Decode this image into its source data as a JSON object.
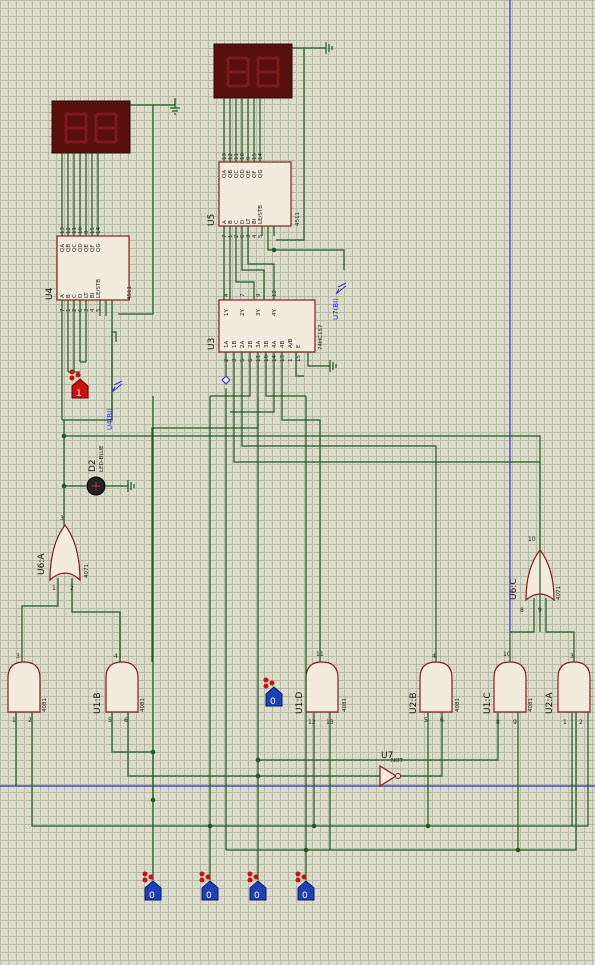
{
  "parts": {
    "U4": {
      "ref": "U4",
      "type": "4511",
      "outputs": [
        "QA",
        "QB",
        "QC",
        "QD",
        "QE",
        "QF",
        "QG"
      ],
      "out_pins": [
        "13",
        "12",
        "11",
        "10",
        "9",
        "15",
        "14"
      ],
      "inputs": [
        "A",
        "B",
        "C",
        "D",
        "LT",
        "BI",
        "LE/STB"
      ],
      "in_pins": [
        "7",
        "1",
        "2",
        "6",
        "3",
        "4",
        "5"
      ]
    },
    "U5": {
      "ref": "U5",
      "type": "4511",
      "outputs": [
        "QA",
        "QB",
        "QC",
        "QD",
        "QE",
        "QF",
        "QG"
      ],
      "out_pins": [
        "13",
        "12",
        "11",
        "10",
        "9",
        "15",
        "14"
      ],
      "inputs": [
        "A",
        "B",
        "C",
        "D",
        "LT",
        "BI",
        "LE/STB"
      ],
      "in_pins": [
        "7",
        "1",
        "2",
        "6",
        "3",
        "4",
        "5"
      ]
    },
    "U3": {
      "ref": "U3",
      "type": "74HC157",
      "outputs": [
        "1Y",
        "2Y",
        "3Y",
        "4Y"
      ],
      "out_pins": [
        "4",
        "7",
        "9",
        "12"
      ],
      "inputs": [
        "1A",
        "1B",
        "2A",
        "2B",
        "3A",
        "3B",
        "4A",
        "4B",
        "A/B",
        "E"
      ],
      "in_pins": [
        "2",
        "3",
        "5",
        "6",
        "11",
        "10",
        "14",
        "13",
        "1",
        "15"
      ]
    },
    "D2": {
      "ref": "D2",
      "type": "LED-BLUE"
    },
    "U6A": {
      "ref": "U6:A",
      "type": "4071",
      "pins": [
        "3",
        "1",
        "2"
      ]
    },
    "U6C": {
      "ref": "U6:C",
      "type": "4071",
      "pins": [
        "10",
        "8",
        "9"
      ]
    },
    "U1B": {
      "ref": "U1:B",
      "type": "4081",
      "pins": [
        "4",
        "5",
        "6"
      ]
    },
    "U1D": {
      "ref": "U1:D",
      "type": "4081",
      "pins": [
        "11",
        "12",
        "13"
      ]
    },
    "U1C": {
      "ref": "U1:C",
      "type": "4081",
      "pins": [
        "10",
        "8",
        "9"
      ]
    },
    "U2A": {
      "ref": "U2:A",
      "type": "4081",
      "pins": [
        "3",
        "1",
        "2"
      ]
    },
    "U2B": {
      "ref": "U2:B",
      "type": "4081",
      "pins": [
        "4",
        "5",
        "6"
      ]
    },
    "U_A": {
      "ref": "",
      "type": "4081",
      "pins": [
        "3",
        "1",
        "2"
      ]
    },
    "U7": {
      "ref": "U7",
      "type": "NOT"
    },
    "probe_u4": "U4(BI)",
    "probe_u5": "U7(BI)",
    "logic_red": "1",
    "logic_mid": "0",
    "logic_bottom": [
      "0",
      "0",
      "0",
      "0"
    ]
  },
  "colors": {
    "wire": "#1f5a1f",
    "chip_outline": "#8b1a1a",
    "display_body": "#5a0f0f",
    "logic_high": "#cc1010",
    "logic_low": "#1d3fb8",
    "bus_blue": "#2a2ae0"
  }
}
